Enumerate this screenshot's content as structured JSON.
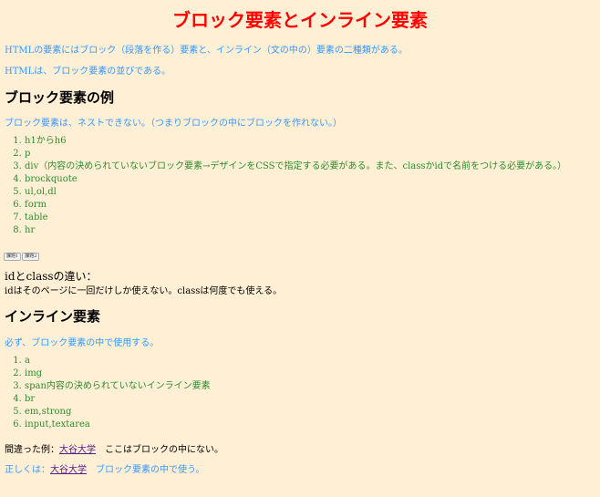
{
  "title": "ブロック要素とインライン要素",
  "intro": [
    "HTMLの要素にはブロック（段落を作る）要素と、インライン（文の中の）要素の二種類がある。",
    "HTMLは、ブロック要素の並びである。"
  ],
  "block": {
    "heading": "ブロック要素の例",
    "note": "ブロック要素は、ネストできない。（つまりブロックの中にブロックを作れない。）",
    "items": [
      "h1からh6",
      "p",
      "div（内容の決められていないブロック要素→デザインをCSSで指定する必要がある。また、classかidで名前をつける必要がある。）",
      "brockquote",
      "ul,ol,dl",
      "form",
      "table",
      "hr"
    ]
  },
  "buttons": [
    "課題1",
    "課題2"
  ],
  "idclass": {
    "heading": "idとclassの違い：",
    "text": "idはそのページに一回だけしか使えない。classは何度でも使える。"
  },
  "inline": {
    "heading": "インライン要素",
    "note": "必ず、ブロック要素の中で使用する。",
    "items": [
      "a",
      "img",
      "span内容の決められていないインライン要素",
      "br",
      "em,strong",
      "input,textarea"
    ]
  },
  "wrong": {
    "label": "間違った例：",
    "link": "大谷大学",
    "after": "　ここはブロックの中にない。"
  },
  "right": {
    "label": "正しくは：",
    "link": "大谷大学",
    "after": "　ブロック要素の中で使う。"
  }
}
